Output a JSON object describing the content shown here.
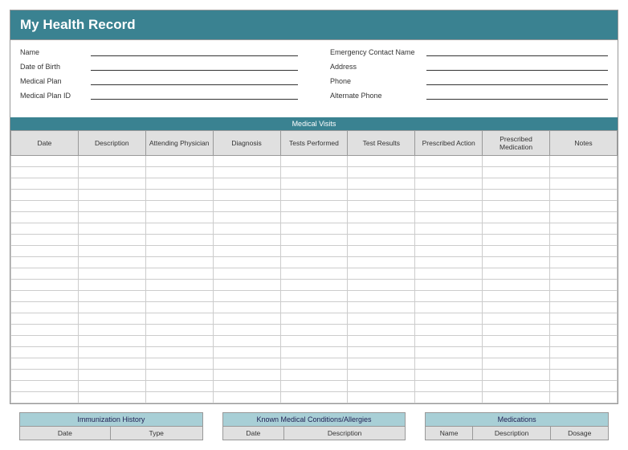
{
  "title": "My Health Record",
  "info_left": [
    {
      "label": "Name"
    },
    {
      "label": "Date of Birth"
    },
    {
      "label": "Medical Plan"
    },
    {
      "label": "Medical Plan ID"
    }
  ],
  "info_right": [
    {
      "label": "Emergency Contact Name"
    },
    {
      "label": "Address"
    },
    {
      "label": "Phone"
    },
    {
      "label": "Alternate Phone"
    }
  ],
  "visits": {
    "title": "Medical Visits",
    "columns": [
      "Date",
      "Description",
      "Attending Physician",
      "Diagnosis",
      "Tests Performed",
      "Test Results",
      "Prescribed Action",
      "Prescribed Medication",
      "Notes"
    ],
    "blank_rows": 22
  },
  "mini_tables": [
    {
      "title": "Immunization History",
      "columns": [
        "Date",
        "Type"
      ]
    },
    {
      "title": "Known Medical Conditions/Allergies",
      "columns": [
        "Date",
        "Description"
      ]
    },
    {
      "title": "Medications",
      "columns": [
        "Name",
        "Description",
        "Dosage"
      ]
    }
  ]
}
